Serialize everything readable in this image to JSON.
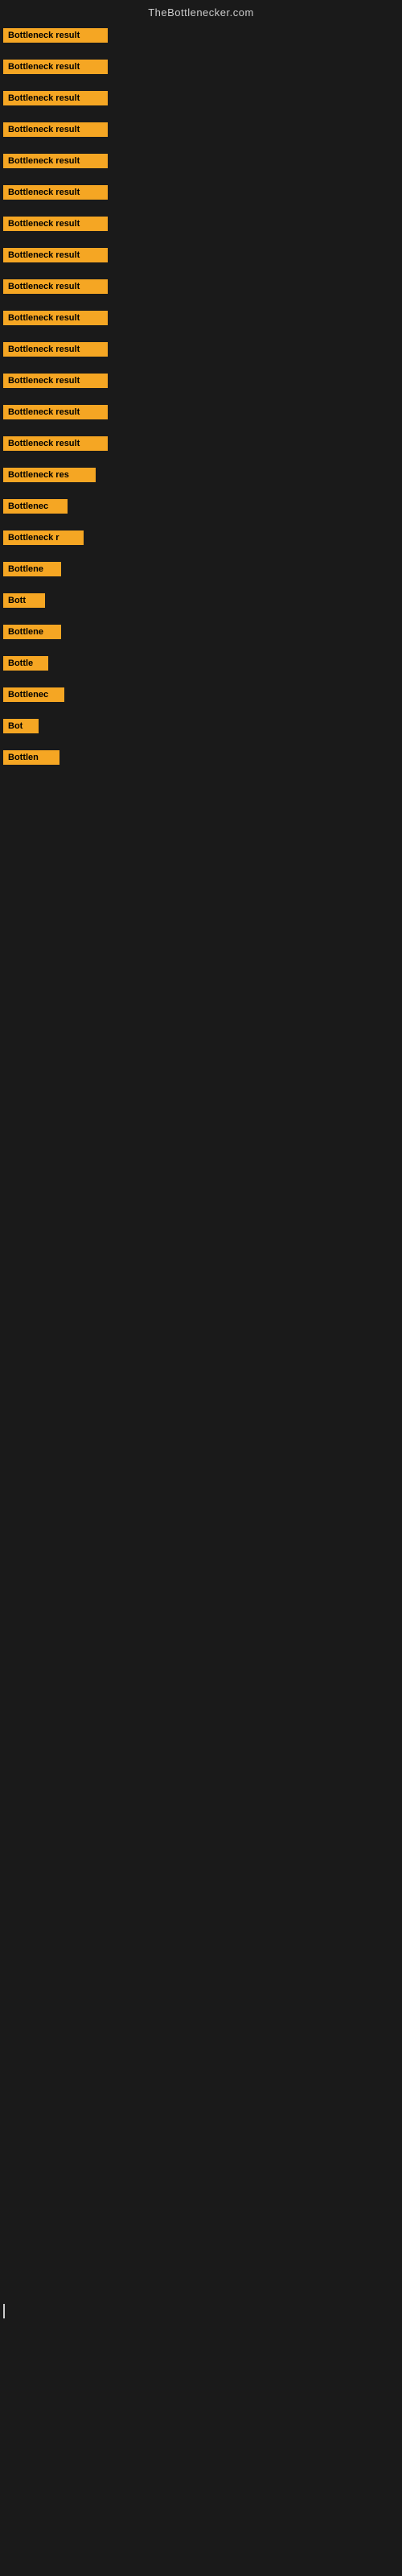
{
  "header": {
    "title": "TheBottlenecker.com"
  },
  "rows": [
    {
      "id": 1,
      "label": "Bottleneck result"
    },
    {
      "id": 2,
      "label": "Bottleneck result"
    },
    {
      "id": 3,
      "label": "Bottleneck result"
    },
    {
      "id": 4,
      "label": "Bottleneck result"
    },
    {
      "id": 5,
      "label": "Bottleneck result"
    },
    {
      "id": 6,
      "label": "Bottleneck result"
    },
    {
      "id": 7,
      "label": "Bottleneck result"
    },
    {
      "id": 8,
      "label": "Bottleneck result"
    },
    {
      "id": 9,
      "label": "Bottleneck result"
    },
    {
      "id": 10,
      "label": "Bottleneck result"
    },
    {
      "id": 11,
      "label": "Bottleneck result"
    },
    {
      "id": 12,
      "label": "Bottleneck result"
    },
    {
      "id": 13,
      "label": "Bottleneck result"
    },
    {
      "id": 14,
      "label": "Bottleneck result"
    },
    {
      "id": 15,
      "label": "Bottleneck res"
    },
    {
      "id": 16,
      "label": "Bottlenec"
    },
    {
      "id": 17,
      "label": "Bottleneck r"
    },
    {
      "id": 18,
      "label": "Bottlene"
    },
    {
      "id": 19,
      "label": "Bott"
    },
    {
      "id": 20,
      "label": "Bottlene"
    },
    {
      "id": 21,
      "label": "Bottle"
    },
    {
      "id": 22,
      "label": "Bottlenec"
    },
    {
      "id": 23,
      "label": "Bot"
    },
    {
      "id": 24,
      "label": "Bottlen"
    }
  ]
}
